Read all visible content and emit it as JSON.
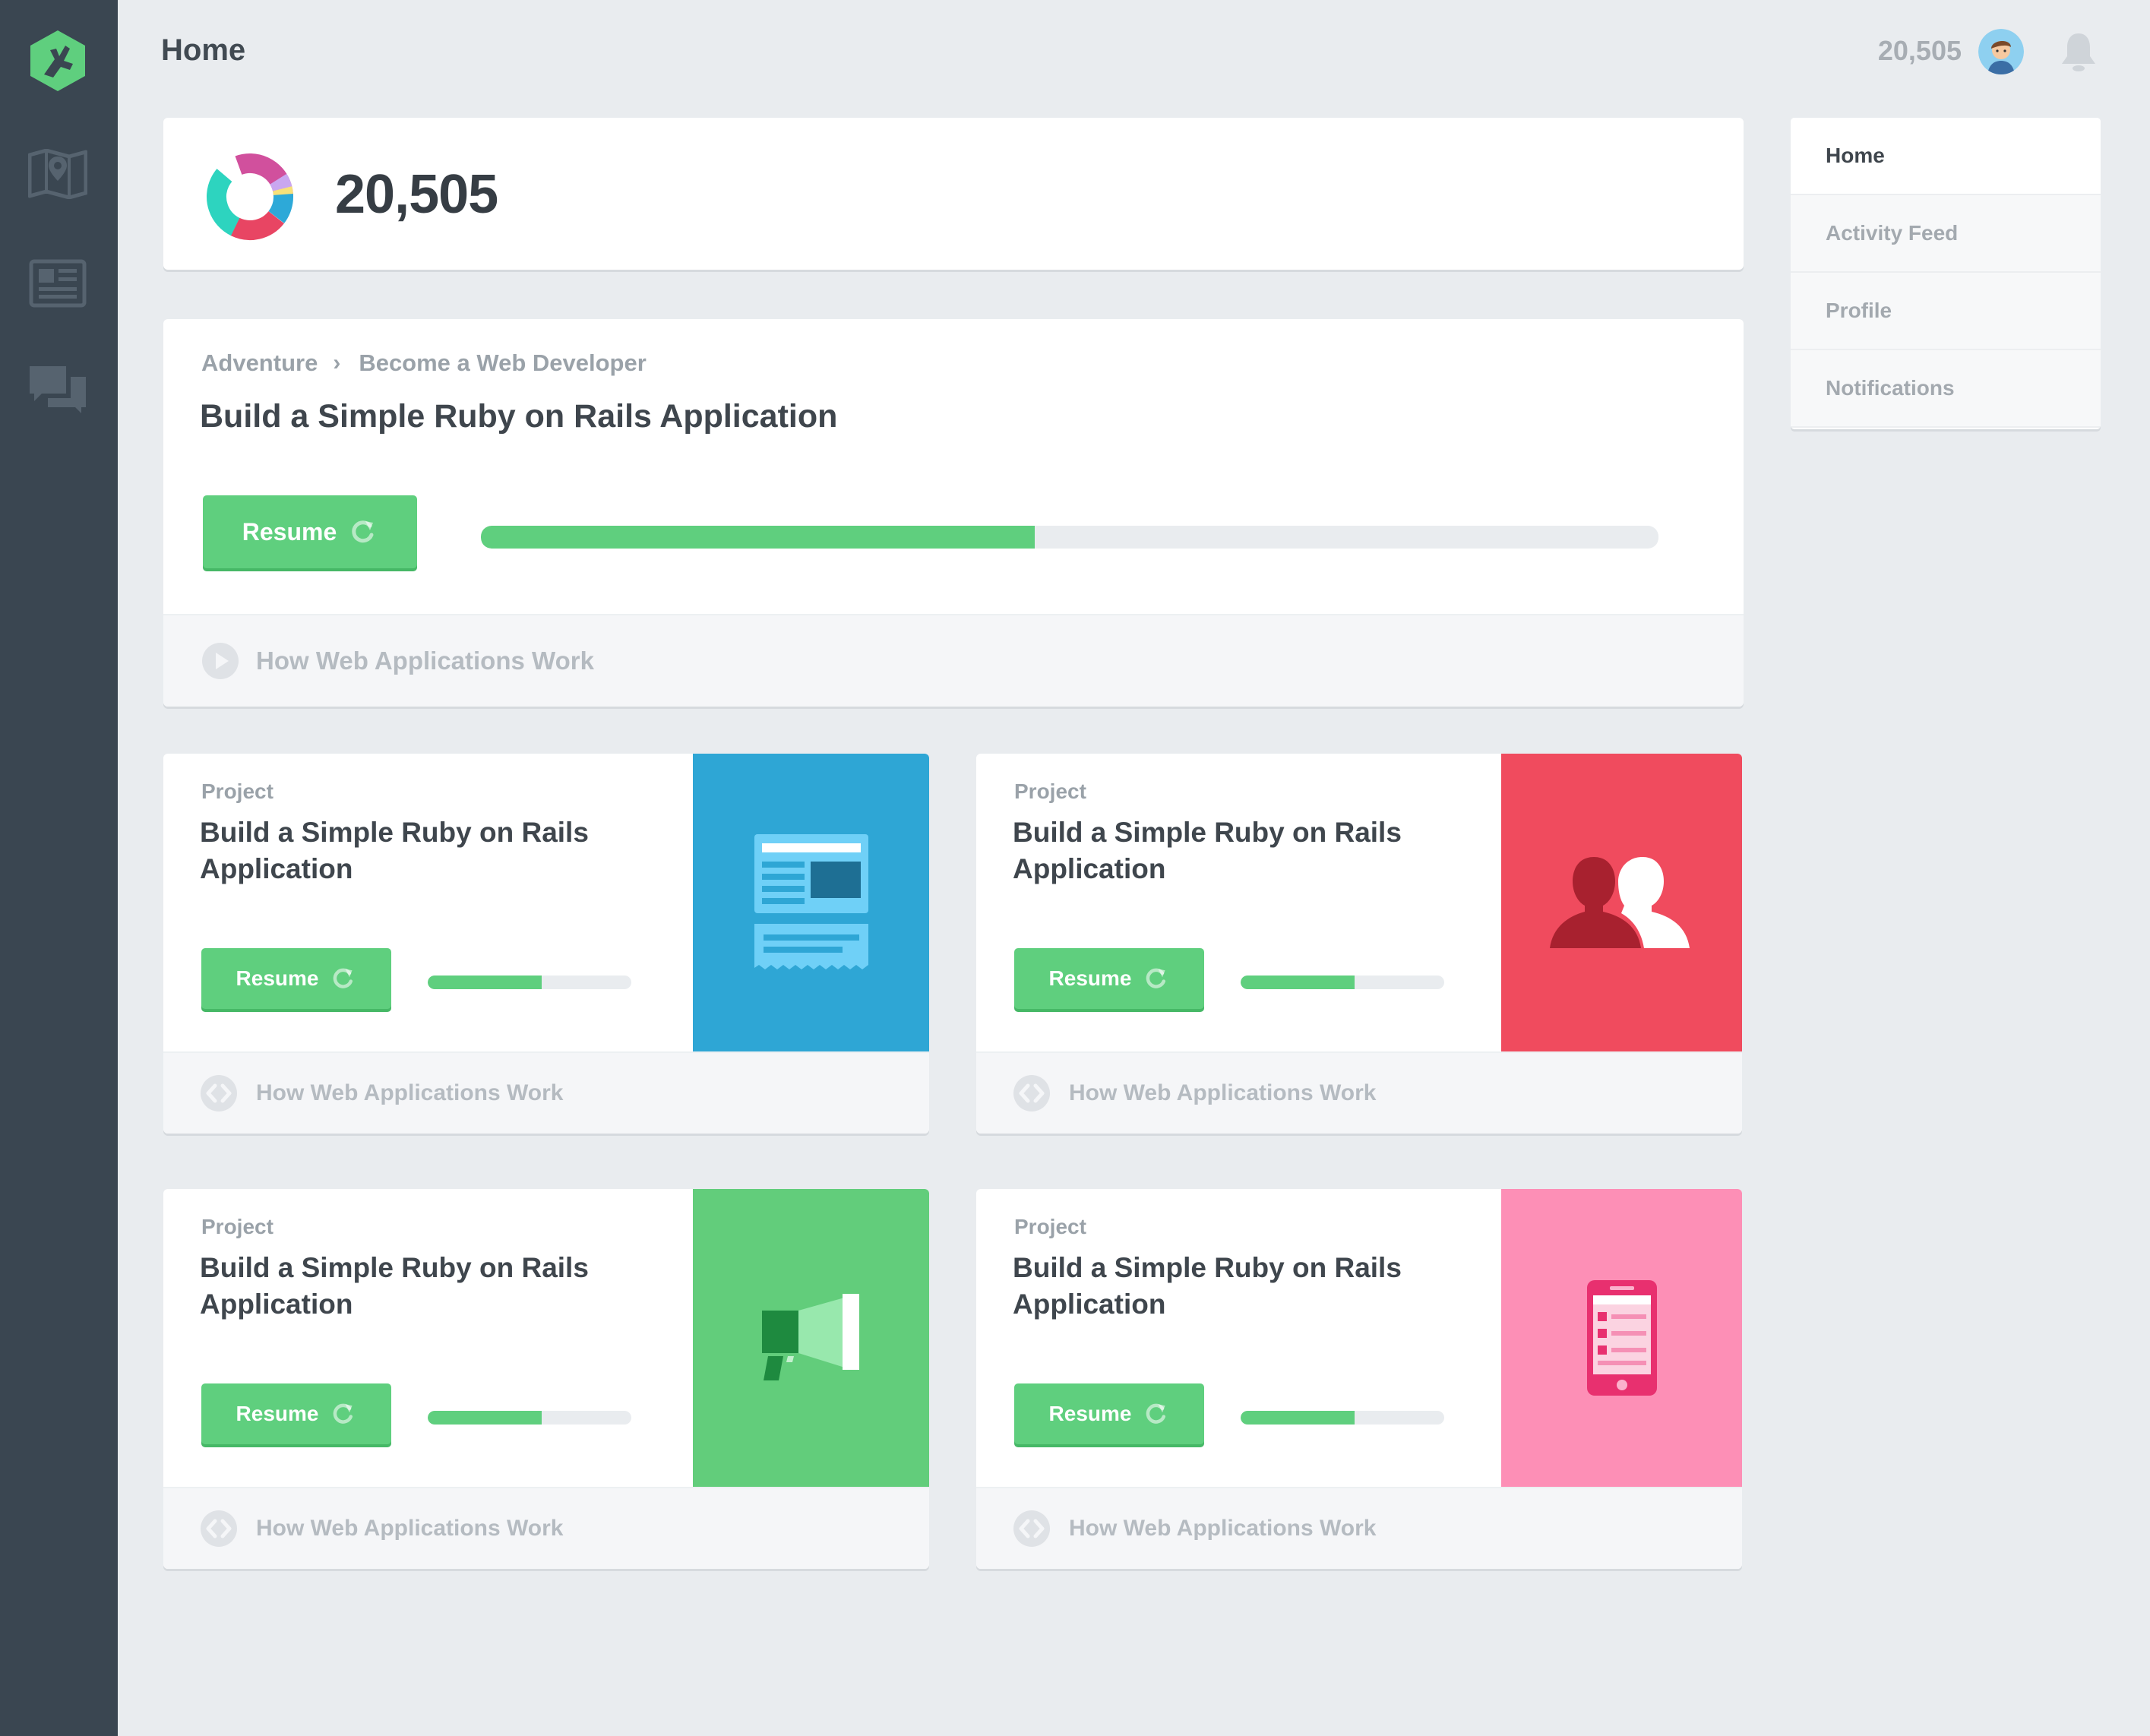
{
  "header": {
    "title": "Home",
    "points": "20,505"
  },
  "sidebar": {
    "items": [
      "logo-icon",
      "map-icon",
      "news-icon",
      "chat-icon"
    ]
  },
  "points_card": {
    "points": "20,505",
    "donut_colors": [
      "#d1509d",
      "#e84563",
      "#2da9d8",
      "#2dd4bf",
      "#c9a7f0",
      "#f7e17a"
    ]
  },
  "adventure": {
    "breadcrumb": [
      "Adventure",
      "Become a Web Developer"
    ],
    "title": "Build a Simple Ruby on Rails Application",
    "resume_label": "Resume",
    "progress": 0.47,
    "footer_label": "How Web Applications Work"
  },
  "projects": [
    {
      "kind": "Project",
      "title": "Build a Simple Ruby on Rails Application",
      "resume_label": "Resume",
      "progress": 0.56,
      "footer_label": "How Web Applications Work",
      "art": "newspaper-icon",
      "color": "#2ea6d5"
    },
    {
      "kind": "Project",
      "title": "Build a Simple Ruby on Rails Application",
      "resume_label": "Resume",
      "progress": 0.56,
      "footer_label": "How Web Applications Work",
      "art": "users-icon",
      "color": "#f04b5e"
    },
    {
      "kind": "Project",
      "title": "Build a Simple Ruby on Rails Application",
      "resume_label": "Resume",
      "progress": 0.56,
      "footer_label": "How Web Applications Work",
      "art": "megaphone-icon",
      "color": "#62cd7b"
    },
    {
      "kind": "Project",
      "title": "Build a Simple Ruby on Rails Application",
      "resume_label": "Resume",
      "progress": 0.56,
      "footer_label": "How Web Applications Work",
      "art": "mobile-icon",
      "color": "#fd8fb6"
    }
  ],
  "right_nav": {
    "items": [
      {
        "label": "Home",
        "active": true
      },
      {
        "label": "Activity Feed",
        "active": false
      },
      {
        "label": "Profile",
        "active": false
      },
      {
        "label": "Notifications",
        "active": false
      }
    ]
  },
  "colors": {
    "accent": "#5fcf7e",
    "sidebar": "#3a4651",
    "background": "#e9ecef"
  }
}
